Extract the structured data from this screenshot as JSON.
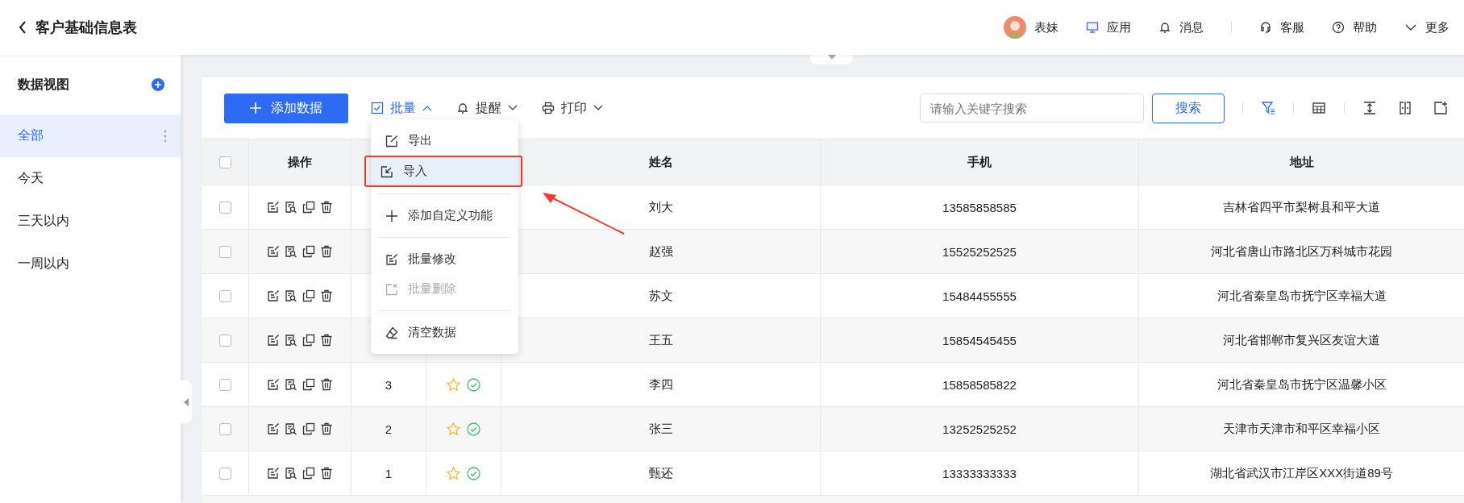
{
  "header": {
    "title": "客户基础信息表",
    "user": "表妹",
    "links": [
      {
        "kind": "apps",
        "label": "应用"
      },
      {
        "kind": "messages",
        "label": "消息"
      },
      {
        "kind": "service",
        "label": "客服"
      },
      {
        "kind": "help",
        "label": "帮助"
      },
      {
        "kind": "more",
        "label": "更多"
      }
    ]
  },
  "sidebar": {
    "title": "数据视图",
    "items": [
      {
        "label": "全部",
        "selected": true
      },
      {
        "label": "今天",
        "selected": false
      },
      {
        "label": "三天以内",
        "selected": false
      },
      {
        "label": "一周以内",
        "selected": false
      }
    ]
  },
  "toolbar": {
    "add_button": "添加数据",
    "menus": [
      {
        "kind": "batch",
        "label": "批量",
        "expanded": true
      },
      {
        "kind": "remind",
        "label": "提醒",
        "expanded": false
      },
      {
        "kind": "print",
        "label": "打印",
        "expanded": false
      }
    ],
    "search": {
      "placeholder": "请输入关键字搜索",
      "button": "搜索"
    }
  },
  "batch_menu": {
    "groups": [
      [
        {
          "kind": "export",
          "label": "导出",
          "disabled": false,
          "annotated": false
        },
        {
          "kind": "import",
          "label": "导入",
          "disabled": false,
          "annotated": true
        }
      ],
      [
        {
          "kind": "add",
          "label": "添加自定义功能",
          "disabled": false,
          "annotated": false
        }
      ],
      [
        {
          "kind": "edit",
          "label": "批量修改",
          "disabled": false,
          "annotated": false
        },
        {
          "kind": "delete",
          "label": "批量删除",
          "disabled": true,
          "annotated": false
        }
      ],
      [
        {
          "kind": "clear",
          "label": "清空数据",
          "disabled": false,
          "annotated": false
        }
      ]
    ]
  },
  "table": {
    "all_checked": false,
    "columns": [
      "操作",
      "姓名",
      "手机",
      "地址"
    ],
    "rows": [
      {
        "checked": false,
        "name": "刘大",
        "phone": "13585858585",
        "address": "吉林省四平市梨树县和平大道"
      },
      {
        "checked": false,
        "name": "赵强",
        "phone": "15525252525",
        "address": "河北省唐山市路北区万科城市花园"
      },
      {
        "checked": false,
        "name": "苏文",
        "phone": "15484455555",
        "address": "河北省秦皇岛市抚宁区幸福大道"
      },
      {
        "checked": false,
        "name": "王五",
        "phone": "15854545455",
        "address": "河北省邯郸市复兴区友谊大道"
      },
      {
        "checked": false,
        "number": "3",
        "starred": false,
        "verified": true,
        "name": "李四",
        "phone": "15858585822",
        "address": "河北省秦皇岛市抚宁区温馨小区"
      },
      {
        "checked": false,
        "number": "2",
        "starred": false,
        "verified": true,
        "name": "张三",
        "phone": "13252525252",
        "address": "天津市天津市和平区幸福小区"
      },
      {
        "checked": false,
        "number": "1",
        "starred": false,
        "verified": true,
        "name": "甄还",
        "phone": "13333333333",
        "address": "湖北省武汉市江岸区XXX街道89号"
      }
    ]
  }
}
